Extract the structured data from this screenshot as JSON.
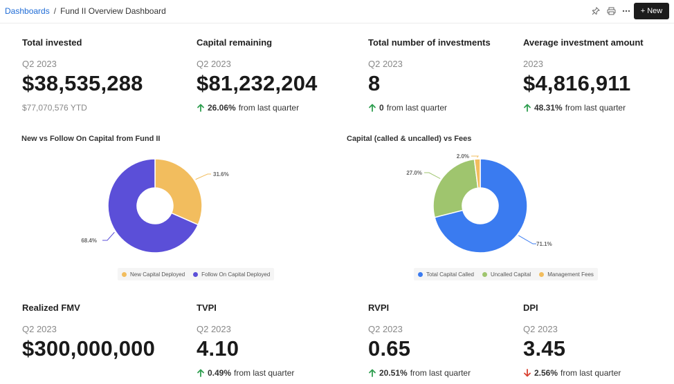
{
  "breadcrumb": {
    "root": "Dashboards",
    "separator": "/",
    "current": "Fund II Overview Dashboard"
  },
  "toolbar": {
    "new_label": "+ New"
  },
  "kpis_top": [
    {
      "title": "Total invested",
      "period": "Q2 2023",
      "value": "$38,535,288",
      "sub": "$77,070,576 YTD"
    },
    {
      "title": "Capital remaining",
      "period": "Q2 2023",
      "value": "$81,232,204",
      "change": "26.06%",
      "direction": "up",
      "change_suffix": "from last quarter"
    },
    {
      "title": "Total number of investments",
      "period": "Q2 2023",
      "value": "8",
      "change": "0",
      "direction": "up",
      "change_suffix": "from last quarter"
    },
    {
      "title": "Average investment amount",
      "period": "2023",
      "value": "$4,816,911",
      "change": "48.31%",
      "direction": "up",
      "change_suffix": "from last quarter"
    }
  ],
  "kpis_bottom": [
    {
      "title": "Realized FMV",
      "period": "Q2 2023",
      "value": "$300,000,000"
    },
    {
      "title": "TVPI",
      "period": "Q2 2023",
      "value": "4.10",
      "change": "0.49%",
      "direction": "up",
      "change_suffix": "from last quarter"
    },
    {
      "title": "RVPI",
      "period": "Q2 2023",
      "value": "0.65",
      "change": "20.51%",
      "direction": "up",
      "change_suffix": "from last quarter"
    },
    {
      "title": "DPI",
      "period": "Q2 2023",
      "value": "3.45",
      "change": "2.56%",
      "direction": "down",
      "change_suffix": "from last quarter"
    }
  ],
  "colors": {
    "up": "#2e9e4f",
    "down": "#d9402f",
    "link": "#1e6bd6"
  },
  "chart_data": [
    {
      "type": "pie",
      "title": "New vs Follow On Capital from Fund II",
      "series": [
        {
          "name": "New Capital Deployed",
          "value": 31.6,
          "label": "31.6%",
          "color": "#f2bd5e"
        },
        {
          "name": "Follow On Capital Deployed",
          "value": 68.4,
          "label": "68.4%",
          "color": "#5b4fd8"
        }
      ]
    },
    {
      "type": "pie",
      "title": "Capital (called & uncalled) vs Fees",
      "series": [
        {
          "name": "Total Capital Called",
          "value": 71.1,
          "label": "71.1%",
          "color": "#3a7bf0"
        },
        {
          "name": "Uncalled Capital",
          "value": 27.0,
          "label": "27.0%",
          "color": "#9fc56e"
        },
        {
          "name": "Management Fees",
          "value": 2.0,
          "label": "2.0%",
          "color": "#f2bd5e"
        }
      ]
    }
  ]
}
